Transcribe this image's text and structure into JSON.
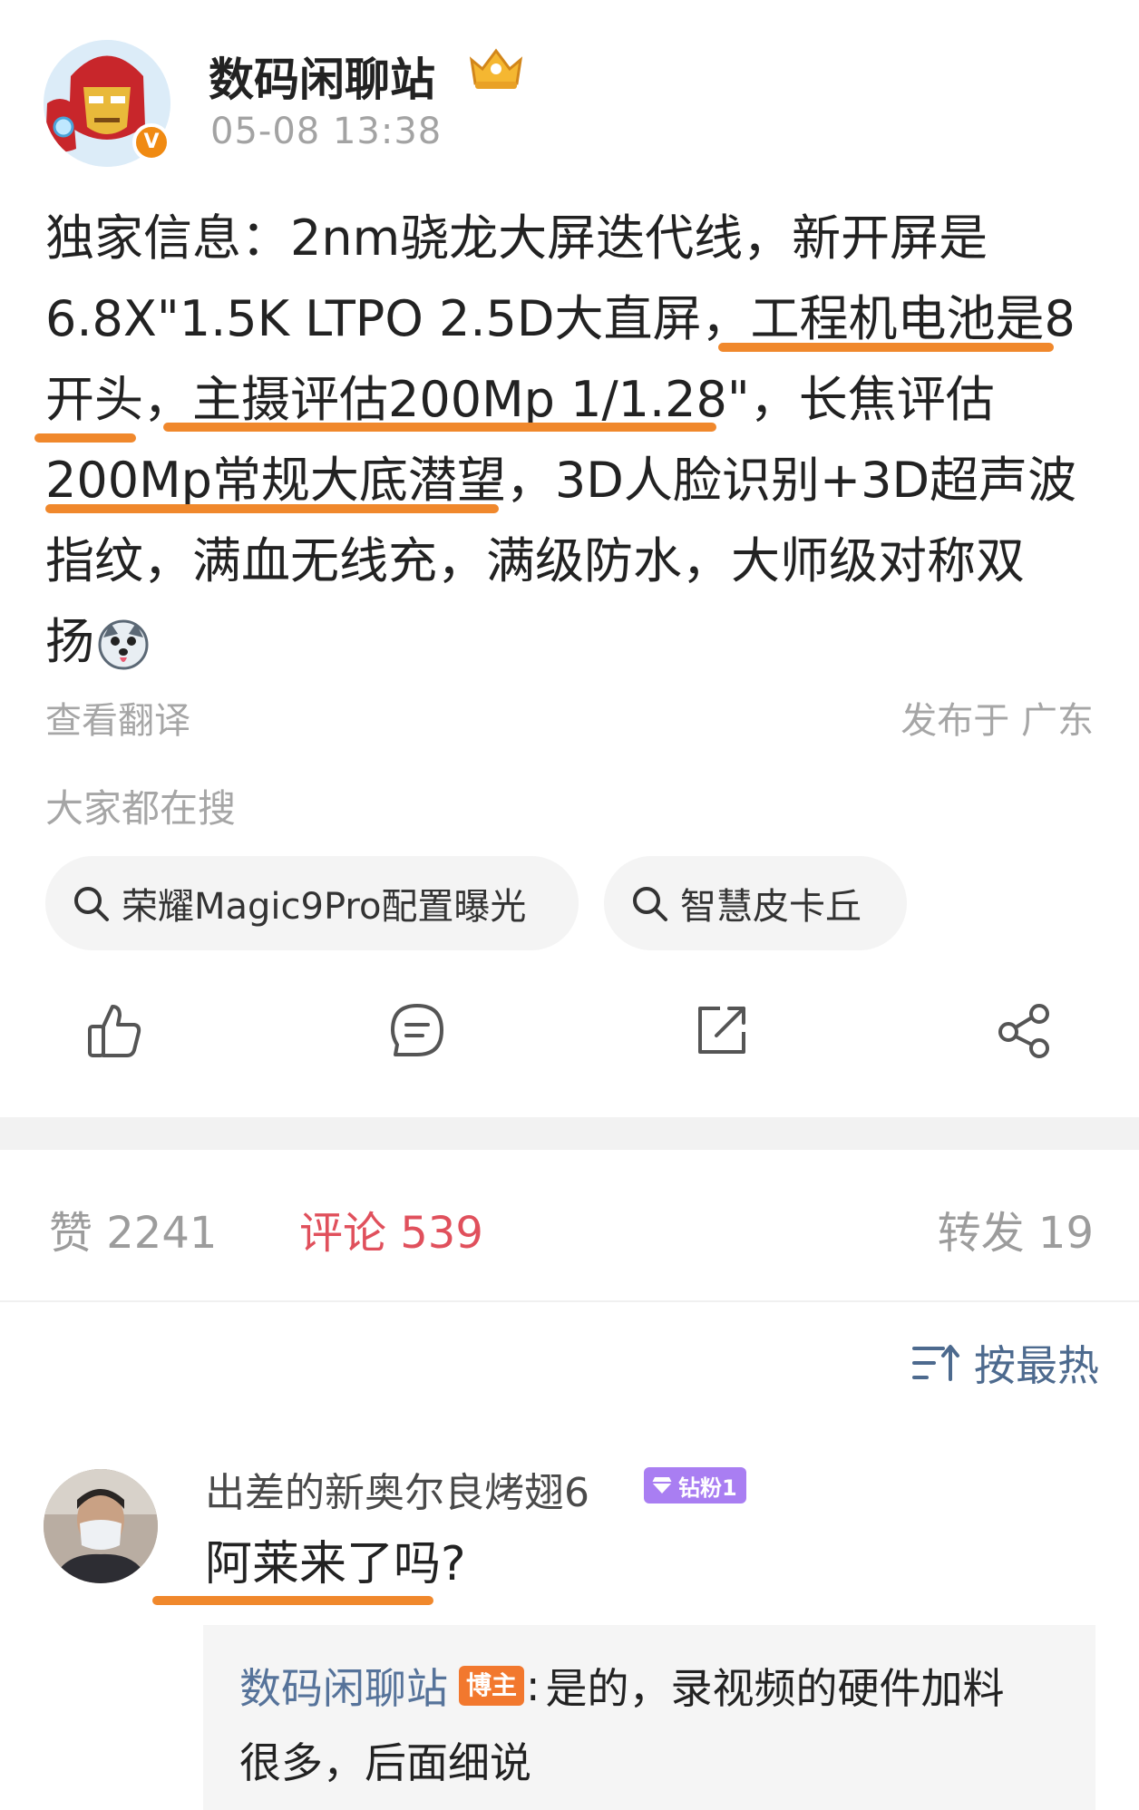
{
  "post": {
    "author": "数码闲聊站",
    "verified_mark": "V",
    "timestamp": "05-08 13:38",
    "lines": [
      "独家信息：2nm骁龙大屏迭代线，新开屏是",
      "6.8X\"1.5K LTPO 2.5D大直屏，工程机电池是8",
      "开头，主摄评估200Mp 1/1.28\"，长焦评估",
      "200Mp常规大底潜望，3D人脸识别+3D超声波",
      "指纹，满血无线充，满级防水，大师级对称双",
      "扬"
    ],
    "translate_label": "查看翻译",
    "location": "发布于 广东"
  },
  "search": {
    "heading": "大家都在搜",
    "chips": [
      "荣耀Magic9Pro配置曝光",
      "智慧皮卡丘"
    ]
  },
  "actions": [
    "like-icon",
    "comment-icon",
    "repost-icon",
    "share-icon"
  ],
  "stats": {
    "likes": "赞 2241",
    "comments": "评论 539",
    "reposts": "转发 19"
  },
  "sort": {
    "label": "按最热"
  },
  "comment": {
    "user": "出差的新奥尔良烤翅6",
    "fan_badge": "钻粉1",
    "text": "阿莱来了吗?",
    "reply": {
      "author": "数码闲聊站",
      "badge": "博主",
      "colon": ":",
      "text_line1": "是的，录视频的硬件加料",
      "text_line2": "很多，后面细说"
    }
  },
  "colors": {
    "highlight": "#f0882c",
    "active_stat": "#e0505c",
    "link_blue": "#56739a",
    "verified": "#f08a12",
    "fan_badge": "#a97ef2",
    "blogger_badge": "#f2782e"
  }
}
